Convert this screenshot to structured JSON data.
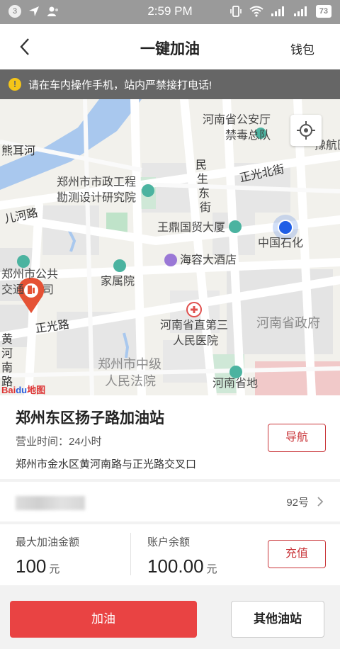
{
  "status_bar": {
    "badge": "3",
    "time": "2:59 PM",
    "battery": "73"
  },
  "header": {
    "title": "一键加油",
    "wallet_label": "钱包"
  },
  "notice": {
    "text": "请在车内操作手机，站内严禁接打电话!"
  },
  "map": {
    "labels": {
      "xiongerhe": "熊耳河",
      "police_1": "河南省公安厅",
      "police_2": "禁毒总队",
      "hospital_partial": "豫航医",
      "zhengzhou_design_1": "郑州市市政工程",
      "zhengzhou_design_2": "勘测设计研究院",
      "minsheng_1": "民",
      "minsheng_2": "生",
      "minsheng_3": "东",
      "minsheng_4": "街",
      "zhengguang_north": "正光北街",
      "ertong_road": "儿河路",
      "wangding": "王鼎国贸大厦",
      "sinopec": "中国石化",
      "bus_1": "郑州市公共",
      "bus_2": "交通",
      "bus_3": "司",
      "hairong": "海容大酒店",
      "jiashuyuan": "家属院",
      "third_hospital_1": "河南省直第三",
      "third_hospital_2": "人民医院",
      "gov": "河南省政府",
      "zhengguang_road": "正光路",
      "huanghe_1": "黄",
      "huanghe_2": "河",
      "huanghe_3": "南",
      "huanghe_4": "路",
      "court_1": "郑州市中级",
      "court_2": "人民法院",
      "geology": "河南省地",
      "baidu_a": "Bai",
      "baidu_b": "du",
      "baidu_c": "地图"
    }
  },
  "station": {
    "name": "郑州东区扬子路加油站",
    "hours": "营业时间：24小时",
    "address": "郑州市金水区黄河南路与正光路交叉口",
    "nav_label": "导航"
  },
  "fuel": {
    "type": "92号"
  },
  "amounts": {
    "max_label": "最大加油金额",
    "max_value": "100",
    "max_unit": "元",
    "balance_label": "账户余额",
    "balance_value": "100.00",
    "balance_unit": "元",
    "recharge_label": "充值"
  },
  "actions": {
    "refuel_label": "加油",
    "other_label": "其他油站"
  },
  "colors": {
    "accent": "#e94343",
    "outline": "#c9363a",
    "notice_bg": "#666666",
    "warn": "#f5c518"
  }
}
